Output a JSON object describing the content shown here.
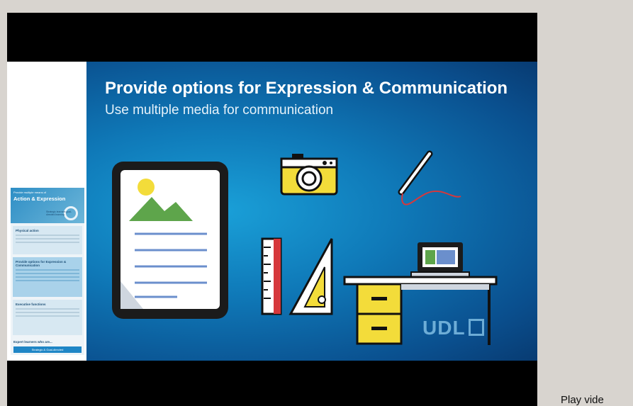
{
  "slide": {
    "title": "Provide options for Expression & Communication",
    "subtitle": "Use multiple media for communication",
    "logo_text": "UDL",
    "thumbnail": {
      "header_small": "Provide multiple means of",
      "header_big": "Action & Expression",
      "header_note": "Strategic learners goal-directed learning",
      "section1_title": "Physical action",
      "section2_title": "Provide options for Expression & Communication",
      "section3_title": "Executive functions",
      "footer_text": "Expert learners who are...",
      "footer_button": "Strategic & Goal-directed"
    },
    "icons": [
      "tablet-icon",
      "camera-icon",
      "pen-icon",
      "ruler-icon",
      "set-square-icon",
      "desk-icon",
      "laptop-icon"
    ]
  },
  "player": {
    "play_label": "Play vide"
  },
  "colors": {
    "page_bg": "#d8d4cf",
    "letterbox": "#000000",
    "slide_blue": "#0f79b8",
    "accent_yellow": "#f3dc3a"
  }
}
